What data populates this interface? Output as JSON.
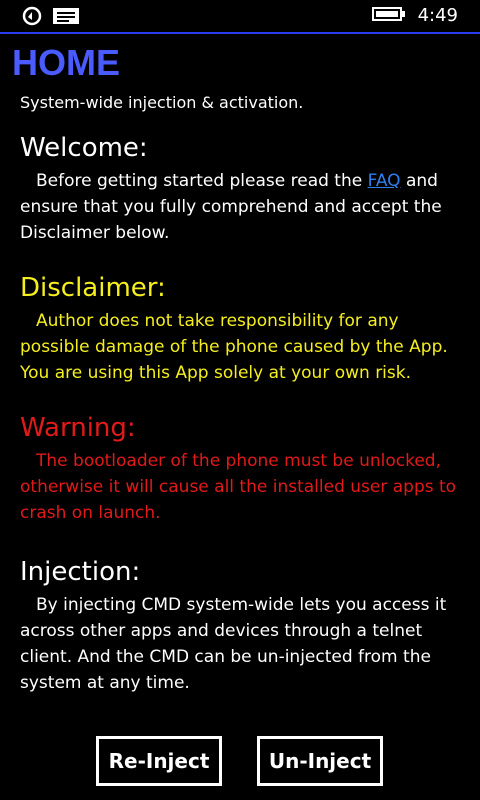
{
  "status_bar": {
    "time": "4:49",
    "icons": [
      "notification-ring-icon",
      "message-icon",
      "battery-icon"
    ]
  },
  "page": {
    "title": "HOME",
    "subtitle": "System-wide injection & activation."
  },
  "welcome": {
    "heading": "Welcome:",
    "text_before_link": "Before getting started please read the ",
    "link": "FAQ",
    "text_after_link": " and ensure that you fully comprehend and accept the Disclaimer below."
  },
  "disclaimer": {
    "heading": "Disclaimer:",
    "text": "Author does not take responsibility for any possible damage of the phone caused by the App. You are using this App solely at your own risk."
  },
  "warning": {
    "heading": "Warning:",
    "text": "The bootloader of the phone must be unlocked, otherwise it will cause all the installed user apps to crash on launch."
  },
  "injection": {
    "heading": "Injection:",
    "text": "By injecting CMD system-wide lets you access it across other apps and devices through a telnet client. And the CMD can be un-injected from the system at any time."
  },
  "buttons": {
    "reinject": "Re-Inject",
    "uninject": "Un-Inject"
  },
  "colors": {
    "title": "#4a5bff",
    "disclaimer": "#f5ef1e",
    "warning": "#e11a1a",
    "link": "#2f7ff0",
    "accent_line": "#2a3df0"
  }
}
